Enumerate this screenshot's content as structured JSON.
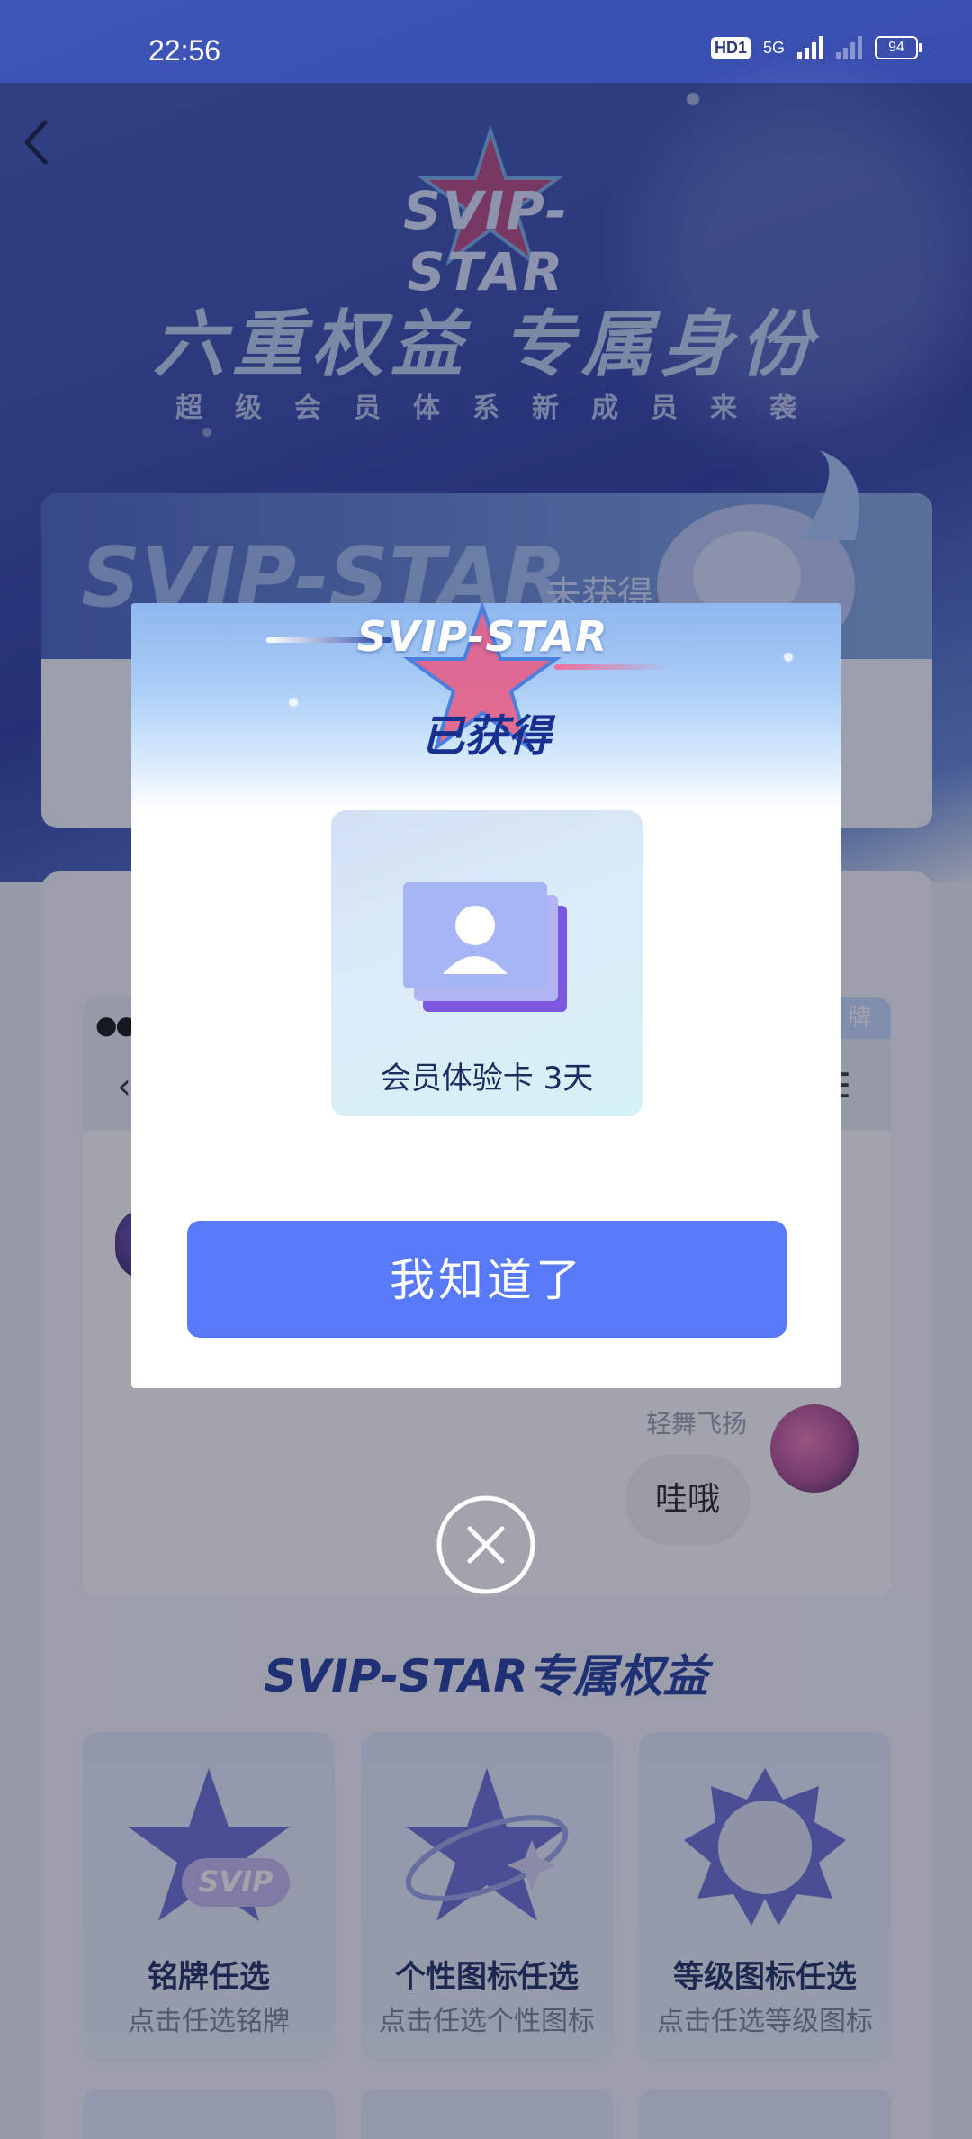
{
  "status_bar": {
    "time": "22:56",
    "network_badge": "HD1",
    "network_type": "5G",
    "battery": "94"
  },
  "hero": {
    "logo_text": "SVIP-STAR",
    "title": "六重权益  专属身份",
    "subtitle": "超级会员体系新成员来袭"
  },
  "status_card": {
    "logo_text": "SVIP-STAR",
    "state": "未获得"
  },
  "chat_preview": {
    "tag": "牌",
    "username": "轻舞飞扬",
    "message": "哇哦"
  },
  "benefits": {
    "title": "SVIP-STAR专属权益",
    "items": [
      {
        "name": "铭牌任选",
        "desc": "点击任选铭牌",
        "icon": "star-svip-icon"
      },
      {
        "name": "个性图标任选",
        "desc": "点击任选个性图标",
        "icon": "star-orbit-icon"
      },
      {
        "name": "等级图标任选",
        "desc": "点击任选等级图标",
        "icon": "sun-badge-icon"
      }
    ]
  },
  "modal": {
    "logo_text": "SVIP-STAR",
    "state": "已获得",
    "reward_label": "会员体验卡 3天",
    "confirm_label": "我知道了"
  },
  "colors": {
    "accent": "#597af8",
    "heading": "#17308f",
    "overlay": "rgba(30,36,60,0.42)"
  }
}
